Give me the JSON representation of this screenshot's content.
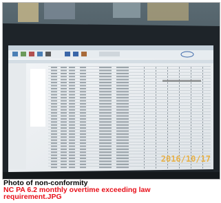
{
  "photo": {
    "timestamp": "2016/10/17",
    "timestamp_color": "#e8b24a",
    "screen_color": "#eef1f3",
    "bezel_color": "#1e2429"
  },
  "caption": {
    "label": "Photo of non-conformity",
    "filename_line1": "NC PA 6.2 monthly overtime exceeding law",
    "filename_line2": "requirement.JPG",
    "label_color": "#000000",
    "filename_color": "#e8101a"
  }
}
